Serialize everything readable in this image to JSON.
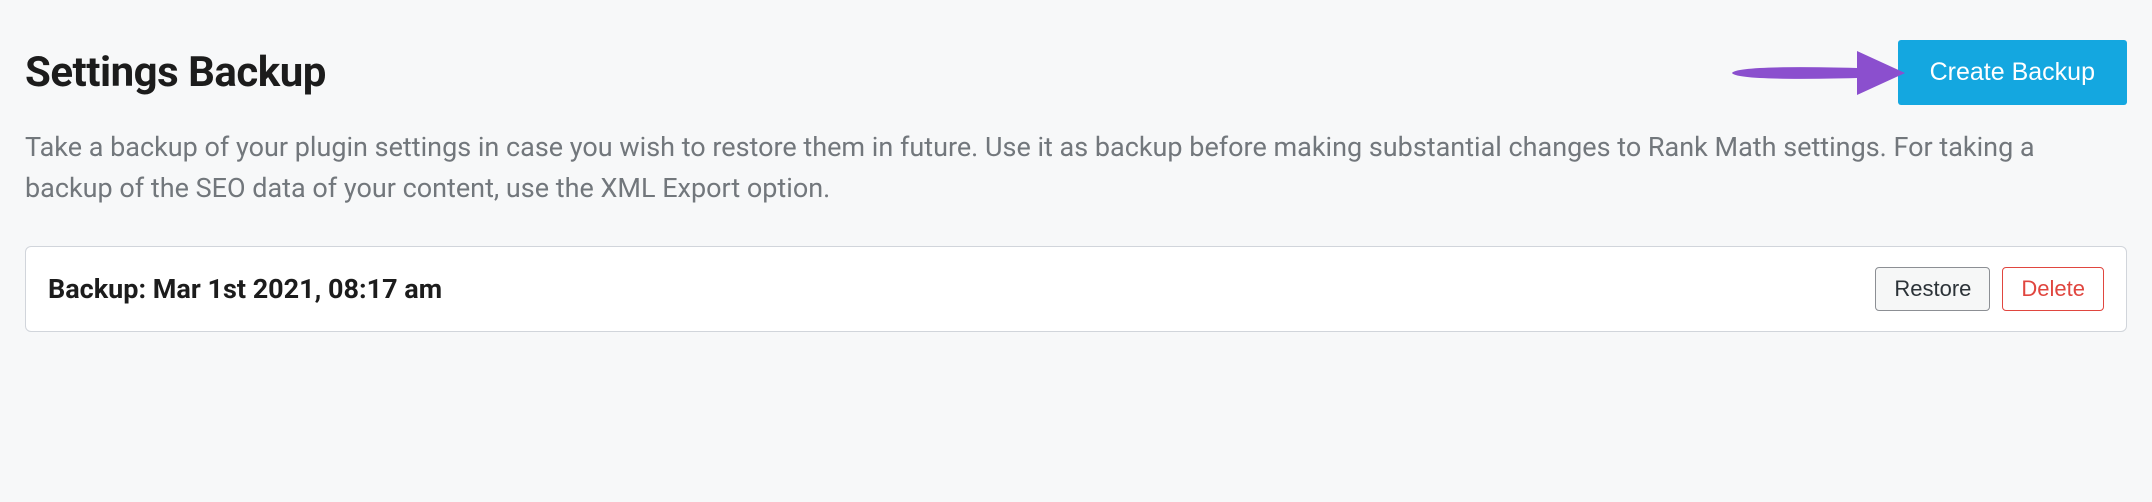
{
  "header": {
    "title": "Settings Backup",
    "create_button_label": "Create Backup"
  },
  "description": "Take a backup of your plugin settings in case you wish to restore them in future. Use it as backup before making substantial changes to Rank Math settings. For taking a backup of the SEO data of your content, use the XML Export option.",
  "backup_row": {
    "label": "Backup: Mar 1st 2021, 08:17 am",
    "restore_label": "Restore",
    "delete_label": "Delete"
  },
  "annotation": {
    "arrow_color": "#8b4fce"
  }
}
